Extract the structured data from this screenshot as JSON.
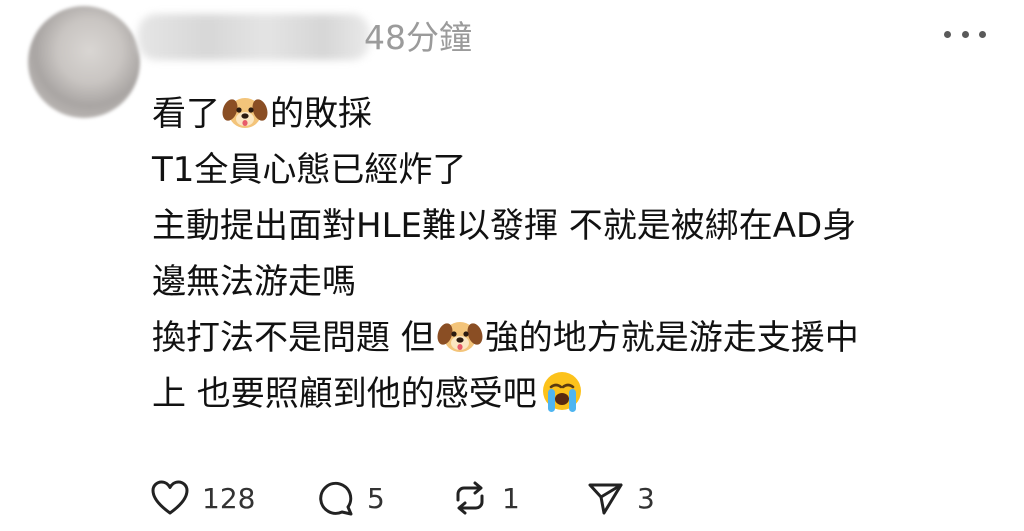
{
  "post": {
    "time": "48分鐘",
    "lines": [
      {
        "before": "看了",
        "emoji": "dog-face",
        "after": "的敗採"
      },
      {
        "text": "T1全員心態已經炸了"
      },
      {
        "text": "主動提出面對HLE難以發揮 不就是被綁在AD身"
      },
      {
        "text": "邊無法游走嗎"
      },
      {
        "before": "換打法不是問題 但",
        "emoji": "dog-face",
        "after": "強的地方就是游走支援中"
      },
      {
        "before": "上 也要照顧到他的感受吧",
        "emoji": "loudly-crying-face",
        "after": ""
      }
    ]
  },
  "actions": {
    "likes": "128",
    "replies": "5",
    "reposts": "1",
    "shares": "3"
  },
  "icons": {
    "like": "heart-icon",
    "reply": "comment-icon",
    "repost": "repost-icon",
    "share": "send-icon",
    "more": "more-icon"
  }
}
